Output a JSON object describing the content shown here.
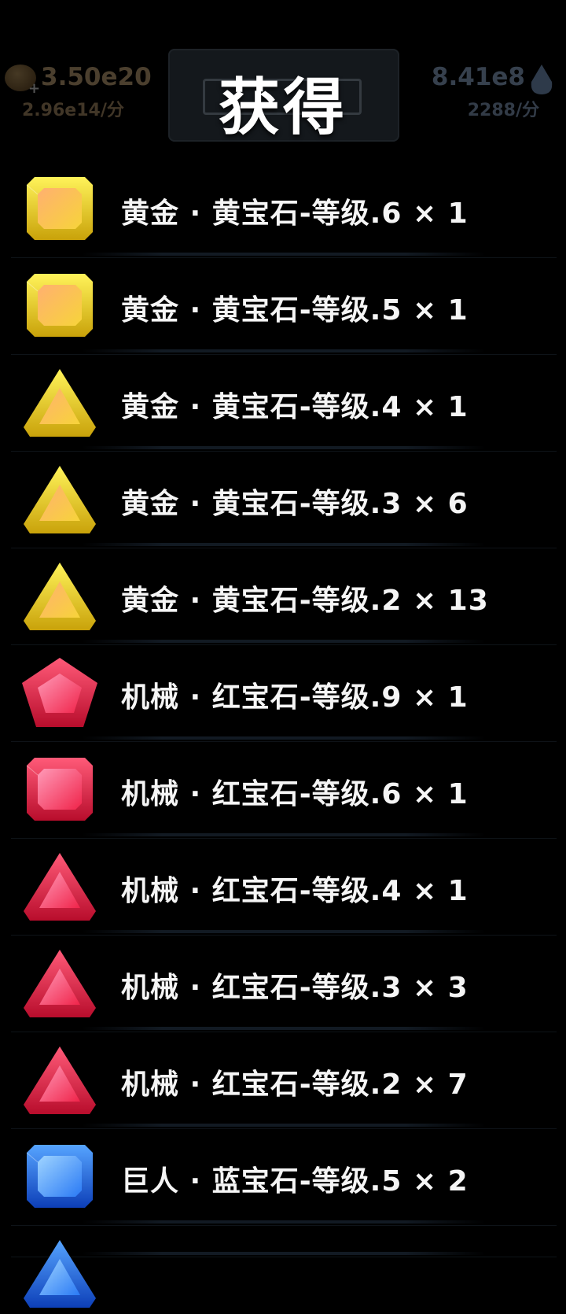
{
  "header": {
    "title": "获得",
    "left_resource": {
      "amount": "3.50e20",
      "rate": "2.96e14/分",
      "icon": "gold-coin-icon"
    },
    "right_resource": {
      "amount": "8.41e8",
      "rate": "2288/分",
      "icon": "water-drop-icon"
    }
  },
  "colors": {
    "gold": "#f2d21e",
    "red": "#e8203e",
    "blue": "#1e6cf0",
    "background": "#000000"
  },
  "rewards": [
    {
      "label": "黄金 · 黄宝石-等级.6 × 1",
      "gem": "yellow-square-gem-icon"
    },
    {
      "label": "黄金 · 黄宝石-等级.5 × 1",
      "gem": "yellow-square-gem-icon"
    },
    {
      "label": "黄金 · 黄宝石-等级.4 × 1",
      "gem": "yellow-triangle-gem-icon"
    },
    {
      "label": "黄金 · 黄宝石-等级.3 × 6",
      "gem": "yellow-triangle-gem-icon"
    },
    {
      "label": "黄金 · 黄宝石-等级.2 × 13",
      "gem": "yellow-triangle-gem-icon"
    },
    {
      "label": "机械 · 红宝石-等级.9 × 1",
      "gem": "red-pentagon-gem-icon"
    },
    {
      "label": "机械 · 红宝石-等级.6 × 1",
      "gem": "red-square-gem-icon"
    },
    {
      "label": "机械 · 红宝石-等级.4 × 1",
      "gem": "red-triangle-gem-icon"
    },
    {
      "label": "机械 · 红宝石-等级.3 × 3",
      "gem": "red-triangle-gem-icon"
    },
    {
      "label": "机械 · 红宝石-等级.2 × 7",
      "gem": "red-triangle-gem-icon"
    },
    {
      "label": "巨人 · 蓝宝石-等级.5 × 2",
      "gem": "blue-square-gem-icon"
    }
  ]
}
